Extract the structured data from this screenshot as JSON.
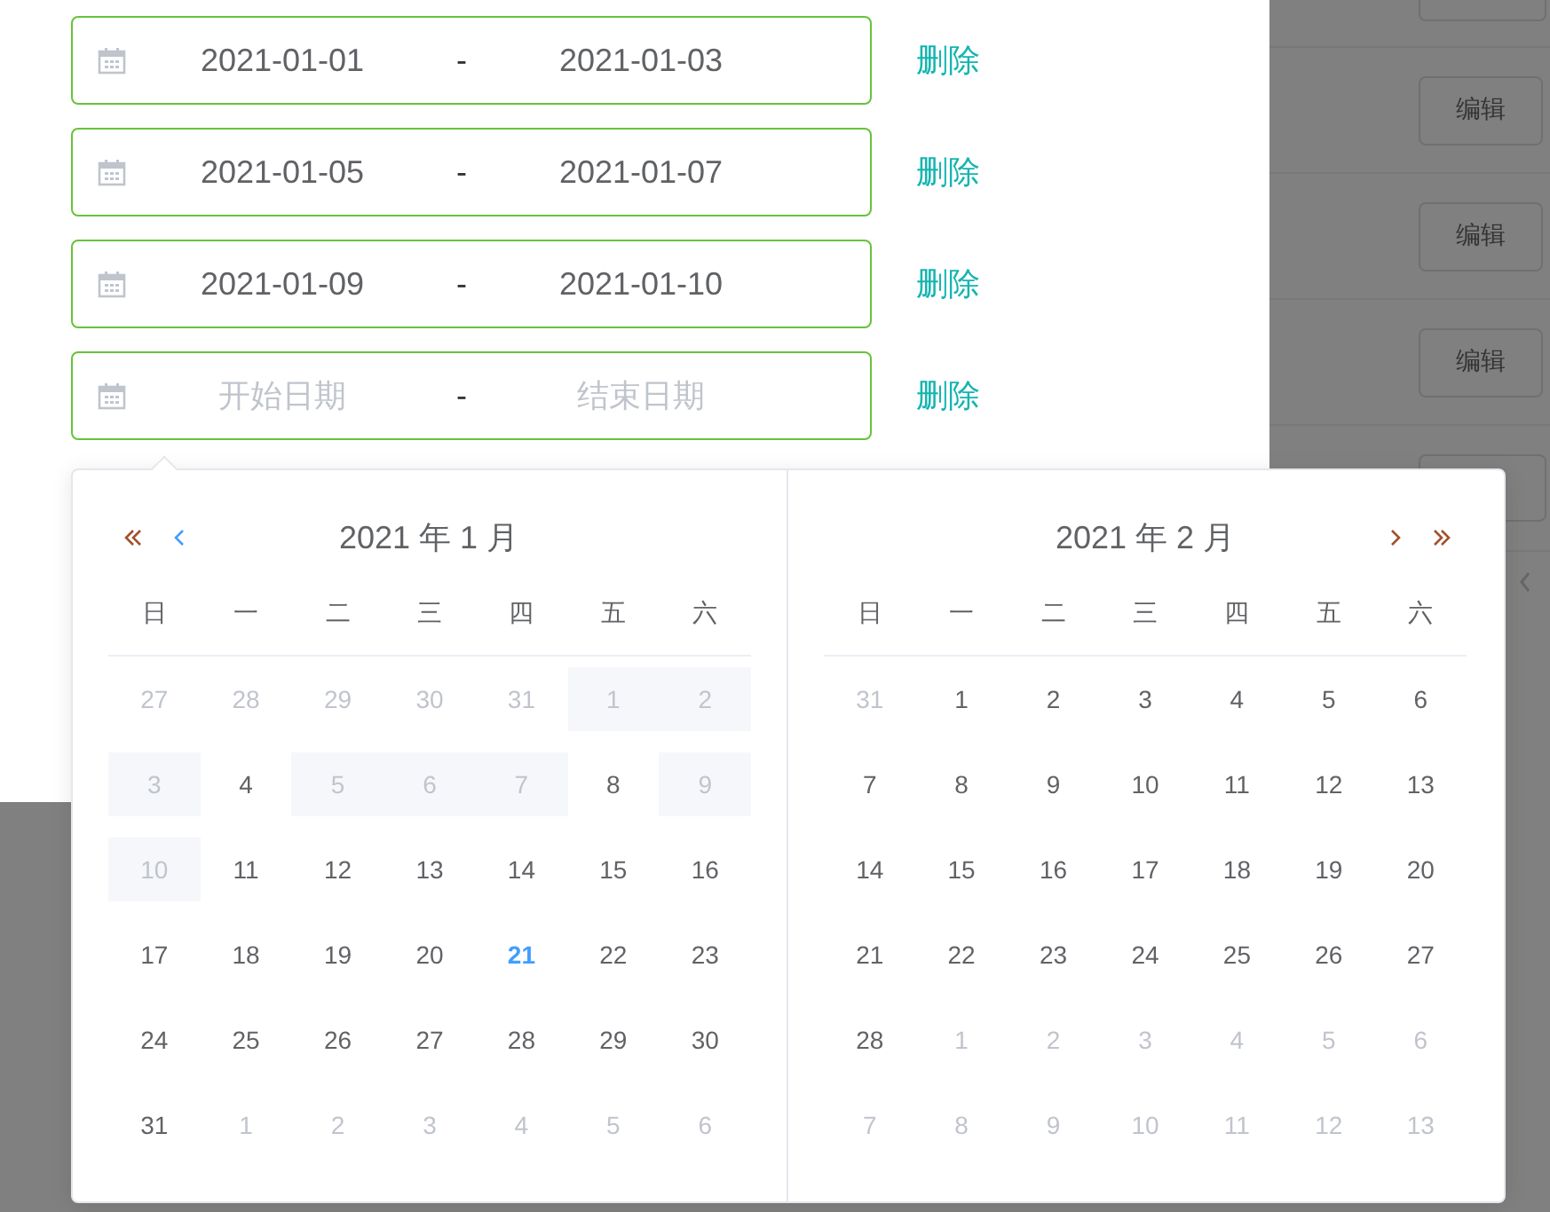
{
  "background": {
    "edit_buttons": [
      "编辑",
      "编辑",
      "编辑"
    ]
  },
  "date_ranges": [
    {
      "start": "2021-01-01",
      "separator": "-",
      "end": "2021-01-03",
      "delete_label": "删除"
    },
    {
      "start": "2021-01-05",
      "separator": "-",
      "end": "2021-01-07",
      "delete_label": "删除"
    },
    {
      "start": "2021-01-09",
      "separator": "-",
      "end": "2021-01-10",
      "delete_label": "删除"
    },
    {
      "start_placeholder": "开始日期",
      "separator": "-",
      "end_placeholder": "结束日期",
      "delete_label": "删除"
    }
  ],
  "picker": {
    "panels": [
      {
        "title": "2021 年 1 月",
        "kind": "left",
        "weekdays": [
          "日",
          "一",
          "二",
          "三",
          "四",
          "五",
          "六"
        ],
        "days": [
          {
            "day": "27",
            "kind": "other"
          },
          {
            "day": "28",
            "kind": "other"
          },
          {
            "day": "29",
            "kind": "other"
          },
          {
            "day": "30",
            "kind": "other"
          },
          {
            "day": "31",
            "kind": "other"
          },
          {
            "day": "1",
            "kind": "disabled"
          },
          {
            "day": "2",
            "kind": "disabled"
          },
          {
            "day": "3",
            "kind": "disabled"
          },
          {
            "day": "4",
            "kind": "normal"
          },
          {
            "day": "5",
            "kind": "disabled"
          },
          {
            "day": "6",
            "kind": "disabled"
          },
          {
            "day": "7",
            "kind": "disabled"
          },
          {
            "day": "8",
            "kind": "normal"
          },
          {
            "day": "9",
            "kind": "disabled"
          },
          {
            "day": "10",
            "kind": "disabled"
          },
          {
            "day": "11",
            "kind": "normal"
          },
          {
            "day": "12",
            "kind": "normal"
          },
          {
            "day": "13",
            "kind": "normal"
          },
          {
            "day": "14",
            "kind": "normal"
          },
          {
            "day": "15",
            "kind": "normal"
          },
          {
            "day": "16",
            "kind": "normal"
          },
          {
            "day": "17",
            "kind": "normal"
          },
          {
            "day": "18",
            "kind": "normal"
          },
          {
            "day": "19",
            "kind": "normal"
          },
          {
            "day": "20",
            "kind": "normal"
          },
          {
            "day": "21",
            "kind": "today"
          },
          {
            "day": "22",
            "kind": "normal"
          },
          {
            "day": "23",
            "kind": "normal"
          },
          {
            "day": "24",
            "kind": "normal"
          },
          {
            "day": "25",
            "kind": "normal"
          },
          {
            "day": "26",
            "kind": "normal"
          },
          {
            "day": "27",
            "kind": "normal"
          },
          {
            "day": "28",
            "kind": "normal"
          },
          {
            "day": "29",
            "kind": "normal"
          },
          {
            "day": "30",
            "kind": "normal"
          },
          {
            "day": "31",
            "kind": "normal"
          },
          {
            "day": "1",
            "kind": "other"
          },
          {
            "day": "2",
            "kind": "other"
          },
          {
            "day": "3",
            "kind": "other"
          },
          {
            "day": "4",
            "kind": "other"
          },
          {
            "day": "5",
            "kind": "other"
          },
          {
            "day": "6",
            "kind": "other"
          }
        ]
      },
      {
        "title": "2021 年 2 月",
        "kind": "right",
        "weekdays": [
          "日",
          "一",
          "二",
          "三",
          "四",
          "五",
          "六"
        ],
        "days": [
          {
            "day": "31",
            "kind": "other"
          },
          {
            "day": "1",
            "kind": "normal"
          },
          {
            "day": "2",
            "kind": "normal"
          },
          {
            "day": "3",
            "kind": "normal"
          },
          {
            "day": "4",
            "kind": "normal"
          },
          {
            "day": "5",
            "kind": "normal"
          },
          {
            "day": "6",
            "kind": "normal"
          },
          {
            "day": "7",
            "kind": "normal"
          },
          {
            "day": "8",
            "kind": "normal"
          },
          {
            "day": "9",
            "kind": "normal"
          },
          {
            "day": "10",
            "kind": "normal"
          },
          {
            "day": "11",
            "kind": "normal"
          },
          {
            "day": "12",
            "kind": "normal"
          },
          {
            "day": "13",
            "kind": "normal"
          },
          {
            "day": "14",
            "kind": "normal"
          },
          {
            "day": "15",
            "kind": "normal"
          },
          {
            "day": "16",
            "kind": "normal"
          },
          {
            "day": "17",
            "kind": "normal"
          },
          {
            "day": "18",
            "kind": "normal"
          },
          {
            "day": "19",
            "kind": "normal"
          },
          {
            "day": "20",
            "kind": "normal"
          },
          {
            "day": "21",
            "kind": "normal"
          },
          {
            "day": "22",
            "kind": "normal"
          },
          {
            "day": "23",
            "kind": "normal"
          },
          {
            "day": "24",
            "kind": "normal"
          },
          {
            "day": "25",
            "kind": "normal"
          },
          {
            "day": "26",
            "kind": "normal"
          },
          {
            "day": "27",
            "kind": "normal"
          },
          {
            "day": "28",
            "kind": "normal"
          },
          {
            "day": "1",
            "kind": "other"
          },
          {
            "day": "2",
            "kind": "other"
          },
          {
            "day": "3",
            "kind": "other"
          },
          {
            "day": "4",
            "kind": "other"
          },
          {
            "day": "5",
            "kind": "other"
          },
          {
            "day": "6",
            "kind": "other"
          },
          {
            "day": "7",
            "kind": "other"
          },
          {
            "day": "8",
            "kind": "other"
          },
          {
            "day": "9",
            "kind": "other"
          },
          {
            "day": "10",
            "kind": "other"
          },
          {
            "day": "11",
            "kind": "other"
          },
          {
            "day": "12",
            "kind": "other"
          },
          {
            "day": "13",
            "kind": "other"
          }
        ]
      }
    ]
  }
}
